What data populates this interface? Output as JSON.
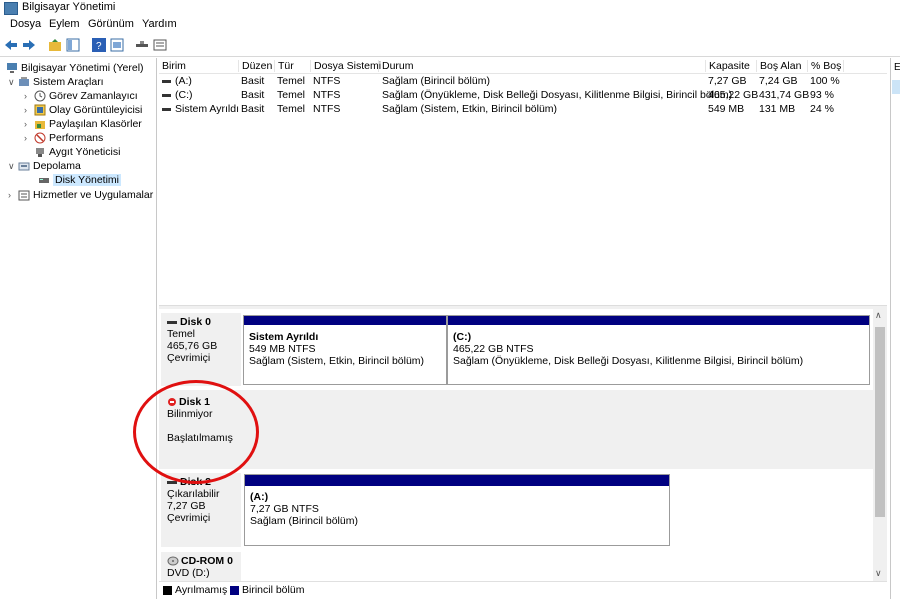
{
  "window": {
    "title": "Bilgisayar Yönetimi"
  },
  "menu": [
    "Dosya",
    "Eylem",
    "Görünüm",
    "Yardım"
  ],
  "tree": {
    "root": "Bilgisayar Yönetimi (Yerel)",
    "system_tools": "Sistem Araçları",
    "task_scheduler": "Görev Zamanlayıcı",
    "event_viewer": "Olay Görüntüleyicisi",
    "shared_folders": "Paylaşılan Klasörler",
    "performance": "Performans",
    "device_manager": "Aygıt Yöneticisi",
    "storage": "Depolama",
    "disk_management": "Disk Yönetimi",
    "services": "Hizmetler ve Uygulamalar"
  },
  "volumes": {
    "headers": [
      "Birim",
      "Düzen",
      "Tür",
      "Dosya Sistemi",
      "Durum",
      "Kapasite",
      "Boş Alan",
      "% Boş"
    ],
    "rows": [
      [
        "(A:)",
        "Basit",
        "Temel",
        "NTFS",
        "Sağlam (Birincil bölüm)",
        "7,27 GB",
        "7,24 GB",
        "100 %"
      ],
      [
        "(C:)",
        "Basit",
        "Temel",
        "NTFS",
        "Sağlam (Önyükleme, Disk Belleği Dosyası, Kilitlenme Bilgisi, Birincil bölüm)",
        "465,22 GB",
        "431,74 GB",
        "93 %"
      ],
      [
        "Sistem Ayrıldı",
        "Basit",
        "Temel",
        "NTFS",
        "Sağlam (Sistem, Etkin, Birincil bölüm)",
        "549 MB",
        "131 MB",
        "24 %"
      ]
    ]
  },
  "disks": {
    "disk0": {
      "name": "Disk 0",
      "type": "Temel",
      "size": "465,76 GB",
      "status": "Çevrimiçi",
      "p1": {
        "title": "Sistem Ayrıldı",
        "size": "549 MB NTFS",
        "status": "Sağlam (Sistem, Etkin, Birincil bölüm)"
      },
      "p2": {
        "title": "(C:)",
        "size": "465,22 GB NTFS",
        "status": "Sağlam (Önyükleme, Disk Belleği Dosyası, Kilitlenme Bilgisi, Birincil bölüm)"
      }
    },
    "disk1": {
      "name": "Disk 1",
      "type": "Bilinmiyor",
      "status": "Başlatılmamış"
    },
    "disk2": {
      "name": "Disk 2",
      "type": "Çıkarılabilir",
      "size": "7,27 GB",
      "status": "Çevrimiçi",
      "p1": {
        "title": "(A:)",
        "size": "7,27 GB NTFS",
        "status": "Sağlam (Birincil bölüm)"
      }
    },
    "cdrom0": {
      "name": "CD-ROM 0",
      "type": "DVD (D:)"
    }
  },
  "legend": {
    "unallocated": "Ayrılmamış",
    "primary": "Birincil bölüm"
  },
  "right_pane": {
    "header": "E"
  },
  "colors": {
    "partition": "#000080",
    "unallocated": "#000000",
    "highlight": "#e01010"
  }
}
